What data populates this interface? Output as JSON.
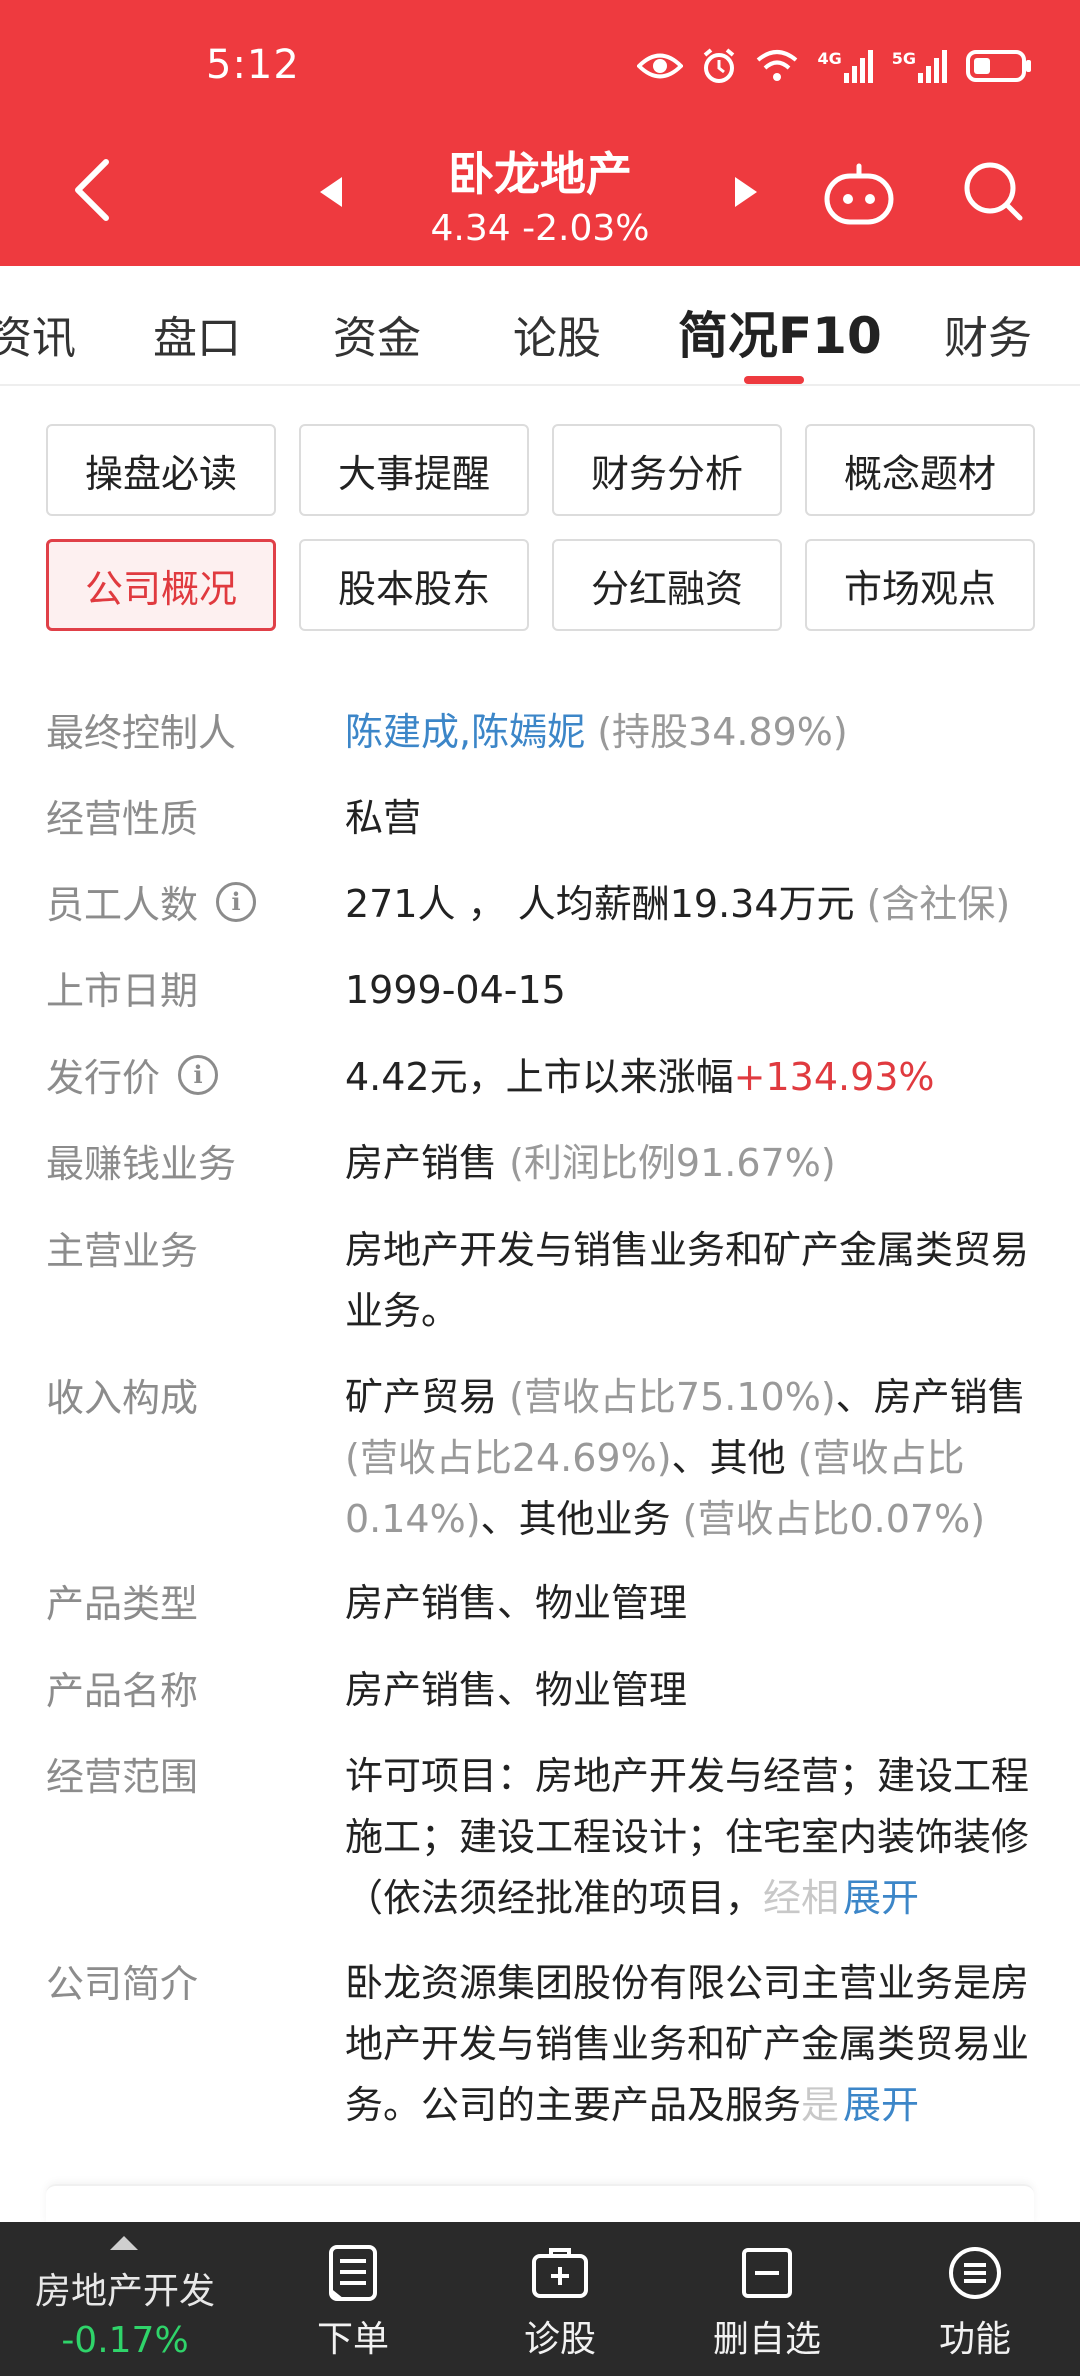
{
  "status_bar": {
    "time": "5:12",
    "signal_4g": "4G",
    "signal_5g": "5G"
  },
  "header": {
    "stock_name": "卧龙地产",
    "price": "4.34",
    "change_pct": "-2.03%",
    "colors": {
      "background": "#ee3a3f",
      "text": "#ffffff"
    }
  },
  "tabs": [
    {
      "label": "资讯",
      "active": false
    },
    {
      "label": "盘口",
      "active": false
    },
    {
      "label": "资金",
      "active": false
    },
    {
      "label": "论股",
      "active": false
    },
    {
      "label": "简况F10",
      "active": true
    },
    {
      "label": "财务",
      "active": false
    }
  ],
  "sections": [
    {
      "label": "操盘必读",
      "active": false
    },
    {
      "label": "大事提醒",
      "active": false
    },
    {
      "label": "财务分析",
      "active": false
    },
    {
      "label": "概念题材",
      "active": false
    },
    {
      "label": "公司概况",
      "active": true
    },
    {
      "label": "股本股东",
      "active": false
    },
    {
      "label": "分红融资",
      "active": false
    },
    {
      "label": "市场观点",
      "active": false
    }
  ],
  "info": {
    "controller": {
      "label": "最终控制人",
      "names": "陈建成,陈嫣妮",
      "holding": "(持股34.89%)"
    },
    "nature": {
      "label": "经营性质",
      "value": "私营"
    },
    "employees": {
      "label": "员工人数",
      "count": "271人 ，",
      "salary": "人均薪酬19.34万元",
      "note": "(含社保)"
    },
    "listing_date": {
      "label": "上市日期",
      "value": "1999-04-15"
    },
    "issue_price": {
      "label": "发行价",
      "value": "4.42元，上市以来涨幅",
      "gain": "+134.93%"
    },
    "top_business": {
      "label": "最赚钱业务",
      "value": "房产销售",
      "note": "(利润比例91.67%)"
    },
    "main_business": {
      "label": "主营业务",
      "value": "房地产开发与销售业务和矿产金属类贸易业务。"
    },
    "revenue": {
      "label": "收入构成",
      "items": [
        {
          "name": "矿产贸易",
          "share": "(营收占比75.10%)"
        },
        {
          "name": "房产销售",
          "share": "(营收占比24.69%)"
        },
        {
          "name": "其他",
          "share": "(营收占比0.14%)"
        },
        {
          "name": "其他业务",
          "share": "(营收占比0.07%)"
        }
      ],
      "separator": "、"
    },
    "product_type": {
      "label": "产品类型",
      "value": "房产销售、物业管理"
    },
    "product_name": {
      "label": "产品名称",
      "value": "房产销售、物业管理"
    },
    "scope": {
      "label": "经营范围",
      "text": "许可项目：房地产开发与经营；建设工程施工；建设工程设计；住宅室内装饰装修（依法须经批准的项目，",
      "faded": "经相",
      "expand": "展开"
    },
    "profile": {
      "label": "公司简介",
      "text": "卧龙资源集团股份有限公司主营业务是房地产开发与销售业务和矿产金属类贸易业务。公司的主要产品及服务",
      "faded": "是",
      "expand": "展开"
    }
  },
  "bottom_bar": {
    "sector": {
      "name": "房地产开发",
      "change": "-0.17%"
    },
    "items": [
      {
        "label": "下单",
        "icon": "order-doc-icon"
      },
      {
        "label": "诊股",
        "icon": "diagnose-kit-icon"
      },
      {
        "label": "删自选",
        "icon": "remove-watchlist-icon"
      },
      {
        "label": "功能",
        "icon": "menu-circle-icon"
      }
    ]
  }
}
